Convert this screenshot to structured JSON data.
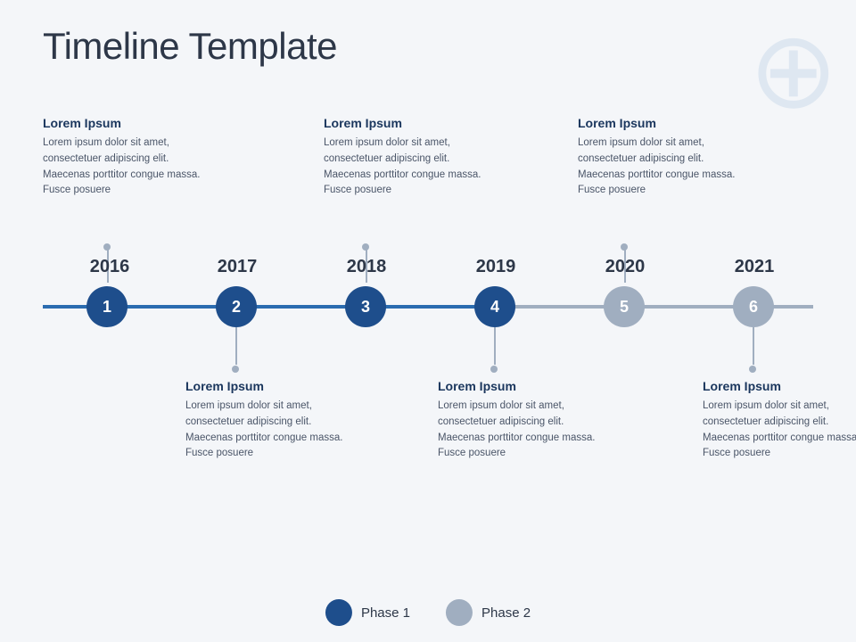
{
  "page": {
    "title": "Timeline Template",
    "bg_color": "#f4f6f9"
  },
  "top_cards": [
    {
      "id": 1,
      "title": "Lorem Ipsum",
      "body": "Lorem ipsum dolor sit amet, consectetuer adipiscing elit. Maecenas porttitor congue massa. Fusce posuere"
    },
    {
      "id": 3,
      "title": "Lorem Ipsum",
      "body": "Lorem ipsum dolor sit amet, consectetuer adipiscing elit. Maecenas porttitor congue massa. Fusce posuere"
    },
    {
      "id": 5,
      "title": "Lorem Ipsum",
      "body": "Lorem ipsum dolor sit amet, consectetuer adipiscing elit. Maecenas porttitor congue massa. Fusce posuere"
    }
  ],
  "bottom_cards": [
    {
      "id": 2,
      "title": "Lorem Ipsum",
      "body": "Lorem ipsum dolor sit amet, consectetuer adipiscing elit. Maecenas porttitor congue massa. Fusce posuere"
    },
    {
      "id": 4,
      "title": "Lorem Ipsum",
      "body": "Lorem ipsum dolor sit amet, consectetuer adipiscing elit. Maecenas porttitor congue massa. Fusce posuere"
    },
    {
      "id": 6,
      "title": "Lorem Ipsum",
      "body": "Lorem ipsum dolor sit amet, consectetuer adipiscing elit. Maecenas porttitor congue massa. Fusce posuere"
    }
  ],
  "years": [
    "2016",
    "2017",
    "2018",
    "2019",
    "2020",
    "2021"
  ],
  "nodes": [
    {
      "number": "1",
      "phase": 1
    },
    {
      "number": "2",
      "phase": 1
    },
    {
      "number": "3",
      "phase": 1
    },
    {
      "number": "4",
      "phase": 1
    },
    {
      "number": "5",
      "phase": 2
    },
    {
      "number": "6",
      "phase": 2
    }
  ],
  "legend": [
    {
      "label": "Phase 1",
      "color": "blue"
    },
    {
      "label": "Phase 2",
      "color": "gray"
    }
  ]
}
